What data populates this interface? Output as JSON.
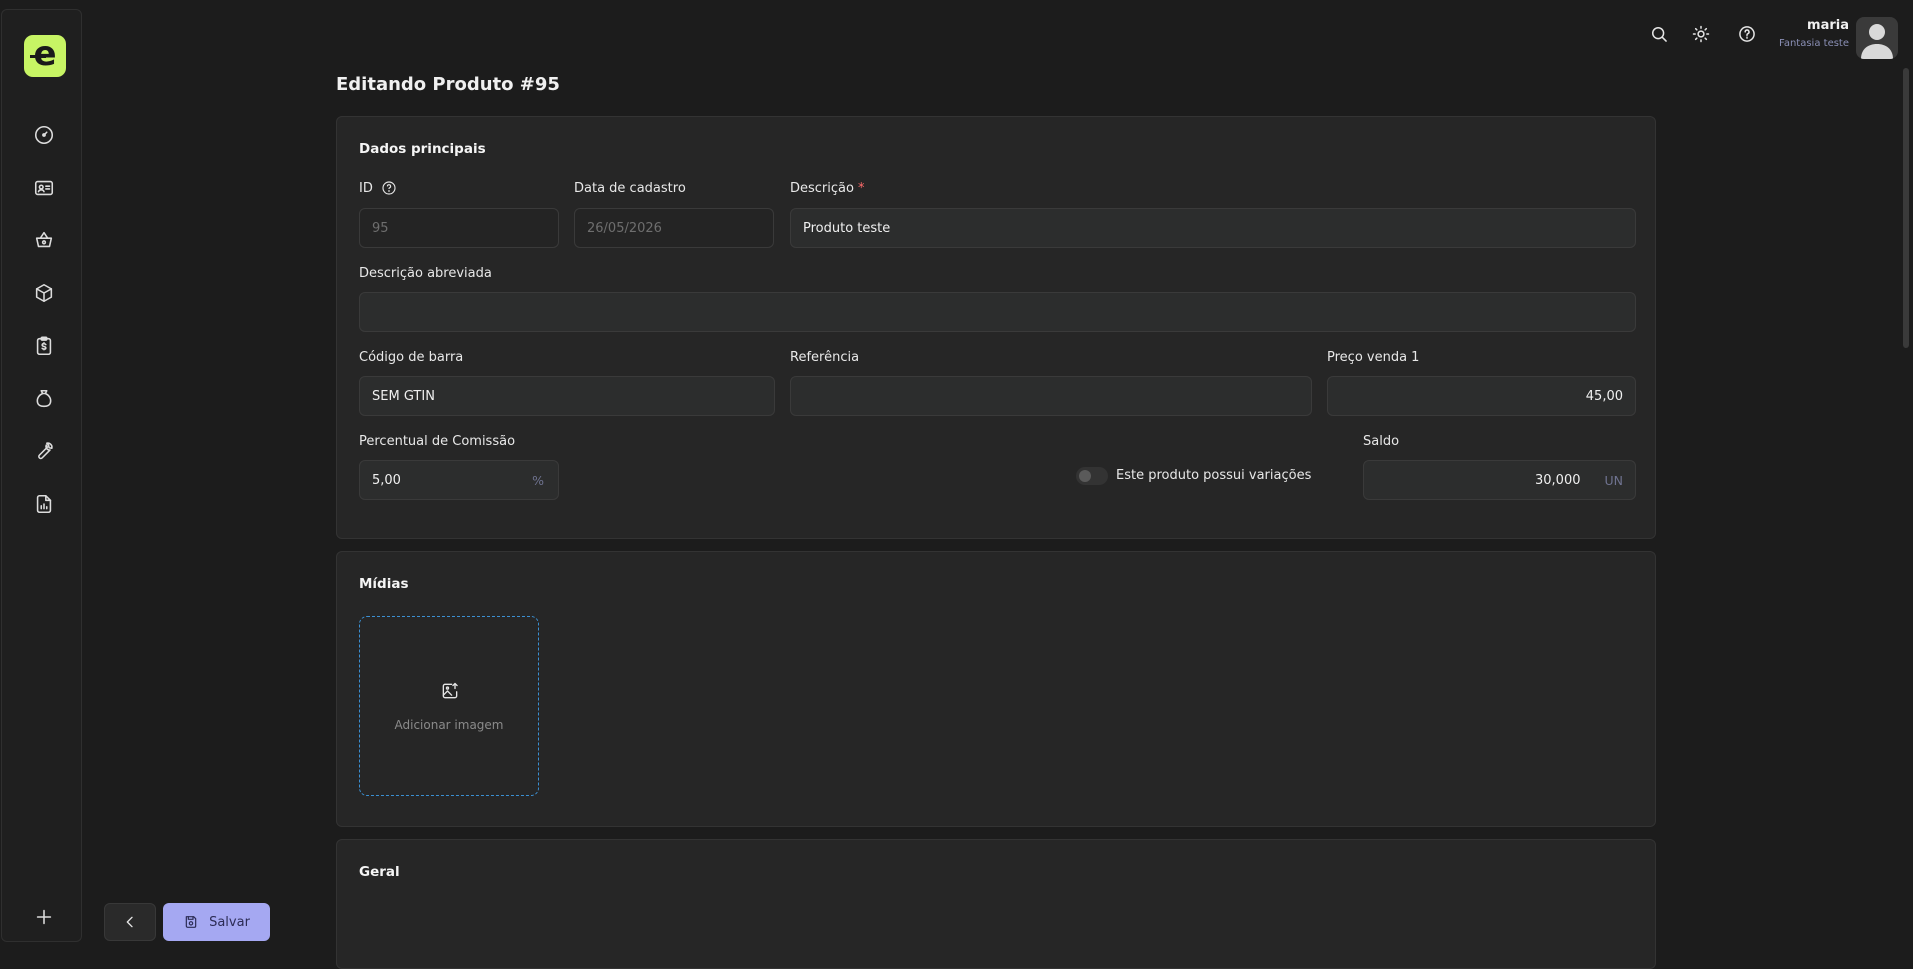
{
  "sidebar": {
    "logo_letter": "e",
    "items": [
      {
        "icon": "dashboard-icon"
      },
      {
        "icon": "contacts-icon"
      },
      {
        "icon": "basket-icon"
      },
      {
        "icon": "box-icon"
      },
      {
        "icon": "clipboard-money-icon"
      },
      {
        "icon": "money-bag-icon"
      },
      {
        "icon": "wrench-icon"
      },
      {
        "icon": "report-icon"
      }
    ],
    "add_icon": "plus-icon"
  },
  "topbar": {
    "user_name": "maria",
    "company": "Fantasia teste"
  },
  "page": {
    "title": "Editando Produto #95"
  },
  "main_data": {
    "title": "Dados principais",
    "id_label": "ID",
    "id_value": "95",
    "date_label": "Data de cadastro",
    "date_value": "26/05/2026",
    "desc_label": "Descrição",
    "desc_required": "*",
    "desc_value": "Produto teste",
    "short_desc_label": "Descrição abreviada",
    "short_desc_value": "",
    "barcode_label": "Código de barra",
    "barcode_value": "SEM GTIN",
    "reference_label": "Referência",
    "reference_value": "",
    "price_label": "Preço venda 1",
    "price_value": "45,00",
    "commission_label": "Percentual de Comissão",
    "commission_value": "5,00",
    "commission_suffix": "%",
    "variations_label": "Este produto possui variações",
    "balance_label": "Saldo",
    "balance_value": "30,000",
    "balance_suffix": "UN"
  },
  "media": {
    "title": "Mídias",
    "upload_label": "Adicionar imagem"
  },
  "general": {
    "title": "Geral"
  },
  "actions": {
    "save_label": "Salvar"
  },
  "colors": {
    "accent_logo": "#c7f464",
    "save_button": "#a5a8f2",
    "required": "#ff6b6b"
  }
}
